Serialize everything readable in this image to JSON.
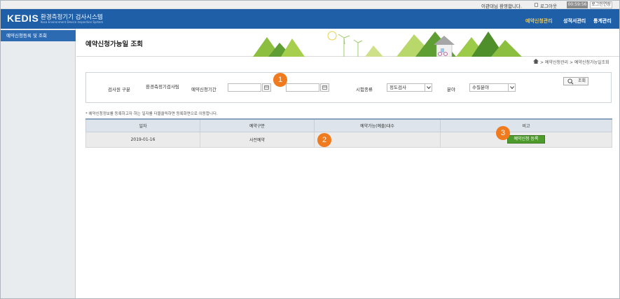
{
  "topbar": {
    "welcome": "이관대님 환영합니다.",
    "logout": "로그아웃",
    "timer": "00:59:56",
    "extend": "로그인연장"
  },
  "header": {
    "logo": "KEDIS",
    "title": "환경측정기기 검사시스템",
    "subtitle": "Kosa Environment Device Inspection System",
    "nav": [
      "예약신청관리",
      "성적서관리",
      "통계관리"
    ],
    "active_nav": "예약신청관리",
    "background": "#1f5fa8",
    "active_color": "#f2c94c"
  },
  "sidebar": {
    "items": [
      {
        "label": "예약신청등록 및 조회"
      }
    ]
  },
  "page": {
    "title": "예약신청가능일 조회",
    "breadcrumb": "> 예약신청관리 > 예약신청가능일조회"
  },
  "search": {
    "org_label": "검사원 구분",
    "org_value": "환경측정기검사팀",
    "period_label": "예약신청기간",
    "start_date": "",
    "end_date": "",
    "test_type_label": "시험종류",
    "test_type_value": "정도검사",
    "field_label": "분야",
    "field_value": "수질분야",
    "search_button": "조회"
  },
  "note": "* 예약신청정보를 등록하고자 하는 일자를 더블클릭하면 등록화면으로 이동합니다.",
  "table": {
    "columns": [
      "일자",
      "예약구분",
      "예약가능(예출)대수",
      "비고"
    ],
    "rows": [
      {
        "date": "2019-01-16",
        "type": "사전예약",
        "count": "",
        "action": "예약신청 등록"
      }
    ]
  },
  "badges": [
    "1",
    "2",
    "3"
  ],
  "colors": {
    "badge": "#f07a1e",
    "register_button": "#4f9a2d",
    "header_row": "#dde4ec"
  }
}
